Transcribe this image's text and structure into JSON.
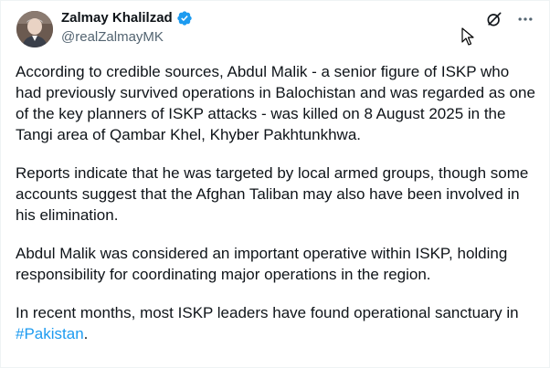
{
  "author": {
    "display_name": "Zalmay Khalilzad",
    "handle": "@realZalmayMK"
  },
  "icons": {
    "avatar": "profile-photo",
    "verified": "verified-badge-icon",
    "grok": "grok-icon",
    "more": "more-options-icon",
    "cursor": "mouse-pointer-icon"
  },
  "colors": {
    "text": "#0f1419",
    "secondary": "#536471",
    "link": "#1d9bf0",
    "verified": "#1d9bf0"
  },
  "tweet": {
    "p1": "According to credible sources, Abdul Malik - a senior figure of ISKP who had previously survived operations in Balochistan and was regarded as one of the key planners of ISKP attacks - was killed on 8 August 2025 in the Tangi area of Qambar Khel, Khyber Pakhtunkhwa.",
    "p2": "Reports indicate that he was targeted by local armed groups, though some accounts suggest that the Afghan Taliban may also have been involved in his elimination.",
    "p3": "Abdul Malik was considered an important operative within ISKP, holding responsibility for coordinating major operations in the region.",
    "p4_prefix": "In recent months, most ISKP leaders have found operational sanctuary in ",
    "p4_hashtag": "#Pakistan",
    "p4_suffix": "."
  }
}
